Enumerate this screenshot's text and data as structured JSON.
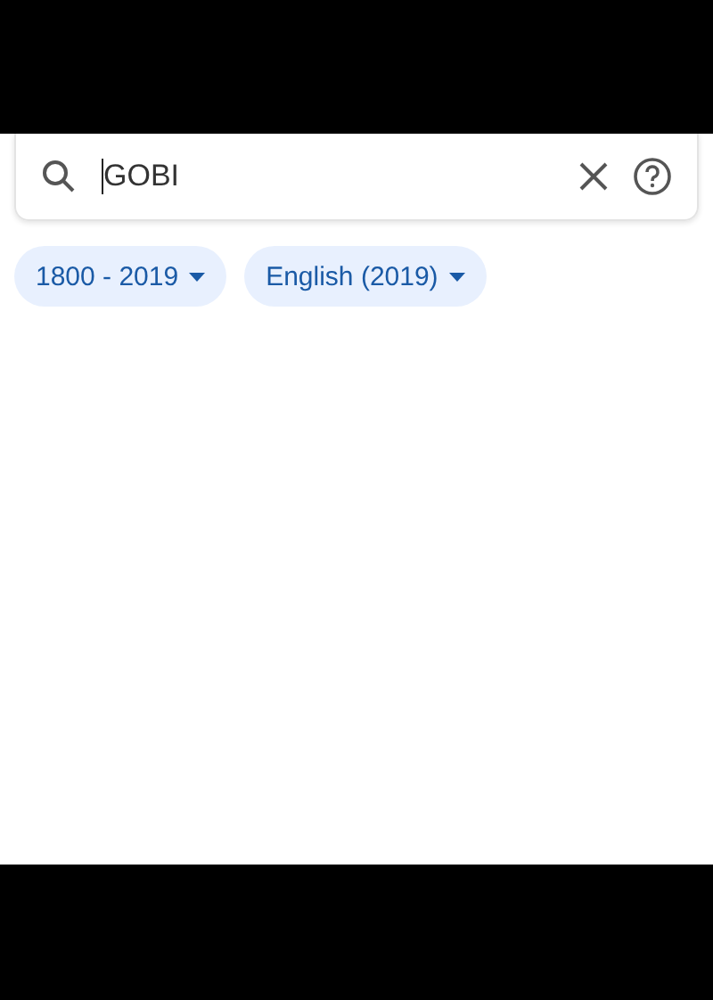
{
  "search": {
    "value": "GOBI"
  },
  "filters": [
    {
      "label": "1800 - 2019"
    },
    {
      "label": "English (2019)"
    }
  ]
}
